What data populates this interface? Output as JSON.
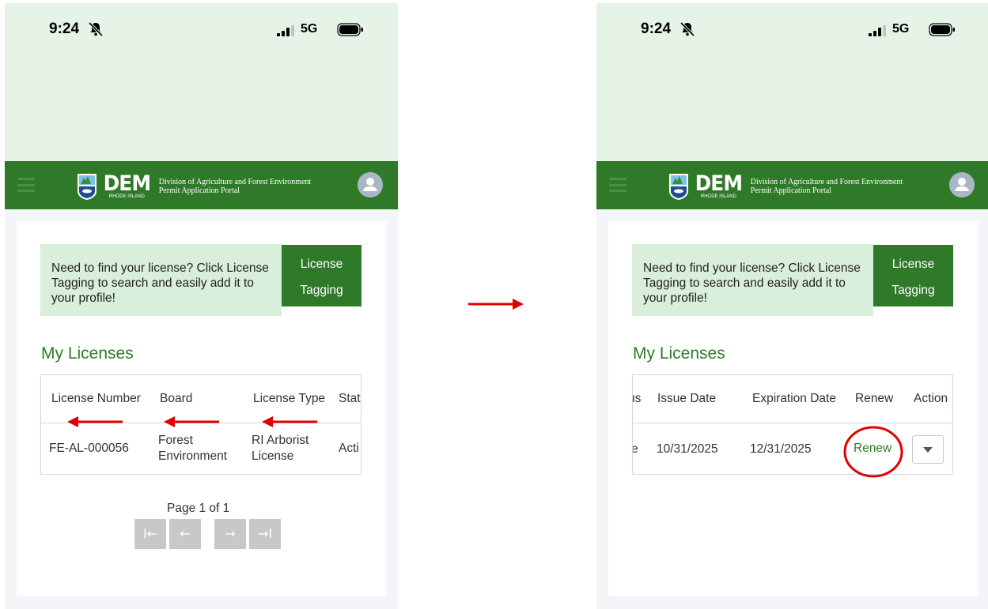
{
  "colors": {
    "brand_green": "#2f7a29",
    "header_mint": "#e5f4e7",
    "notice_mint": "#d9eedb",
    "annotation_red": "#e00000"
  },
  "status_bar": {
    "time": "9:24",
    "network": "5G",
    "bell_icon": "bell-slash-icon",
    "signal_icon": "signal-icon",
    "battery_icon": "battery-icon"
  },
  "header": {
    "logo": "DEM",
    "logo_subtext": "RHODE ISLAND",
    "portal_line1": "Division of Agriculture and Forest Environment",
    "portal_line2": "Permit Application Portal",
    "menu_icon": "hamburger-icon",
    "avatar_icon": "user-avatar-icon"
  },
  "notice": {
    "text": "Need to find your license? Click License Tagging to search and easily add it to your profile!",
    "button_line1": "License",
    "button_line2": "Tagging"
  },
  "section_title": "My Licenses",
  "left_table": {
    "headers": [
      "License Number",
      "Board",
      "License Type",
      "Stat"
    ],
    "row": {
      "license_number": "FE-AL-000056",
      "board_line1": "Forest",
      "board_line2": "Environment",
      "type_line1": "RI Arborist",
      "type_line2": "License",
      "status": "Acti"
    }
  },
  "right_table": {
    "headers": [
      "us",
      "Issue Date",
      "Expiration Date",
      "Renew",
      "Action"
    ],
    "row": {
      "status": "e",
      "issue_date": "10/31/2025",
      "expiration_date": "12/31/2025",
      "renew": "Renew"
    }
  },
  "pagination": {
    "label": "Page 1 of 1",
    "first": "I←",
    "prev": "←",
    "next": "→",
    "last": "→I"
  }
}
